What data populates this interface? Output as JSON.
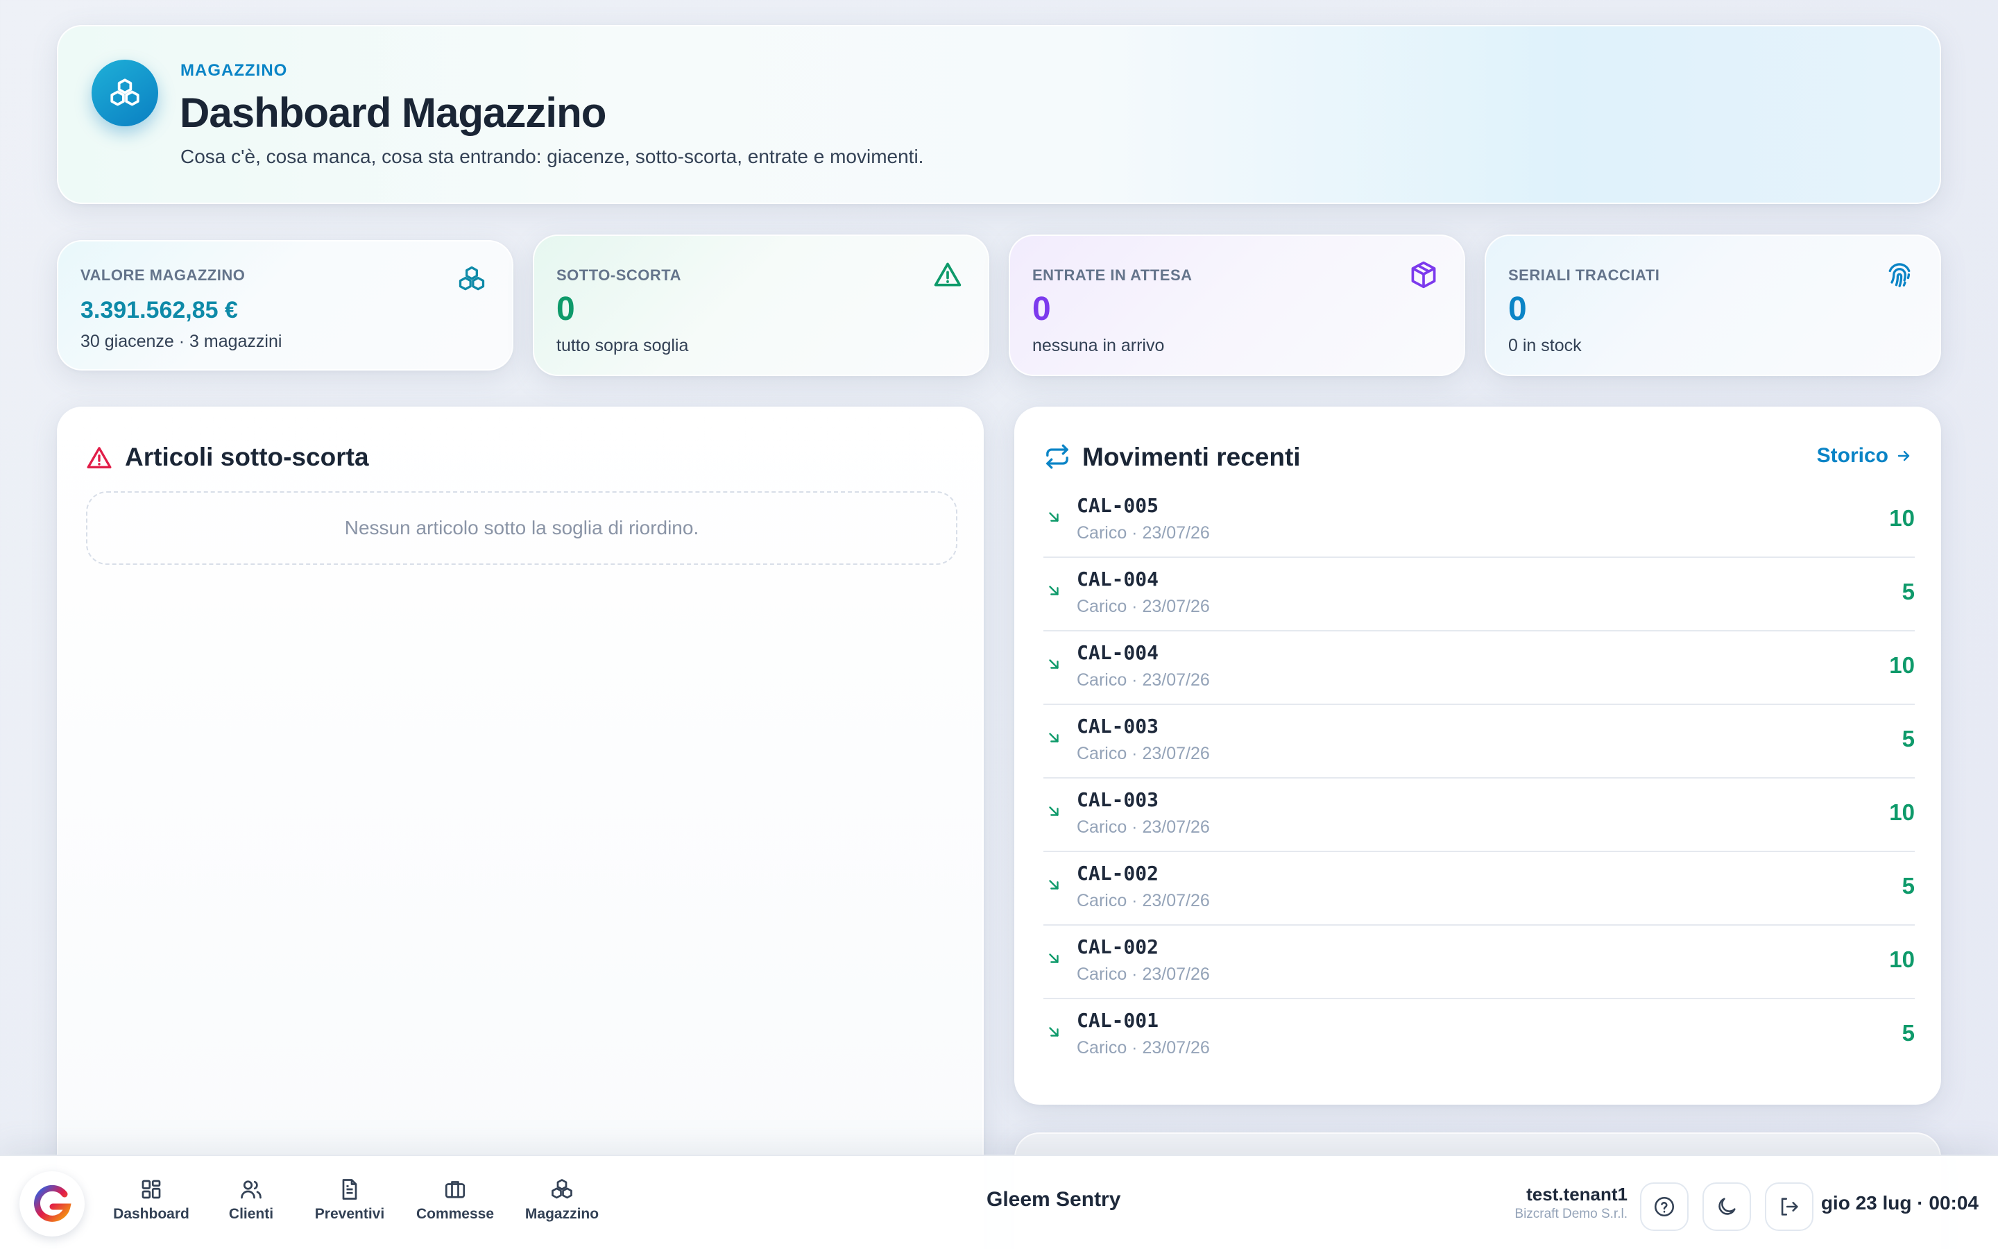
{
  "header": {
    "eyebrow": "MAGAZZINO",
    "title": "Dashboard Magazzino",
    "subtitle": "Cosa c'è, cosa manca, cosa sta entrando: giacenze, sotto-scorta, entrate e movimenti."
  },
  "kpis": [
    {
      "label": "VALORE MAGAZZINO",
      "value": "3.391.562,85 €",
      "sub": "30 giacenze · 3 magazzini",
      "icon": "boxes-icon",
      "color": "#0e8aa8"
    },
    {
      "label": "SOTTO-SCORTA",
      "value": "0",
      "sub": "tutto sopra soglia",
      "icon": "warning-triangle-icon",
      "color": "#0e9a6a"
    },
    {
      "label": "ENTRATE IN ATTESA",
      "value": "0",
      "sub": "nessuna in arrivo",
      "icon": "package-icon",
      "color": "#7c3aed"
    },
    {
      "label": "SERIALI TRACCIATI",
      "value": "0",
      "sub": "0 in stock",
      "icon": "fingerprint-icon",
      "color": "#0a84c6"
    }
  ],
  "low_stock": {
    "title": "Articoli sotto-scorta",
    "empty_text": "Nessun articolo sotto la soglia di riordino."
  },
  "movements": {
    "title": "Movimenti recenti",
    "link_label": "Storico",
    "rows": [
      {
        "code": "CAL-005",
        "meta": "Carico · 23/07/26",
        "qty": "10"
      },
      {
        "code": "CAL-004",
        "meta": "Carico · 23/07/26",
        "qty": "5"
      },
      {
        "code": "CAL-004",
        "meta": "Carico · 23/07/26",
        "qty": "10"
      },
      {
        "code": "CAL-003",
        "meta": "Carico · 23/07/26",
        "qty": "5"
      },
      {
        "code": "CAL-003",
        "meta": "Carico · 23/07/26",
        "qty": "10"
      },
      {
        "code": "CAL-002",
        "meta": "Carico · 23/07/26",
        "qty": "5"
      },
      {
        "code": "CAL-002",
        "meta": "Carico · 23/07/26",
        "qty": "10"
      },
      {
        "code": "CAL-001",
        "meta": "Carico · 23/07/26",
        "qty": "5"
      }
    ]
  },
  "bottom_bar": {
    "nav": [
      {
        "label": "Dashboard",
        "icon": "dashboard-grid-icon"
      },
      {
        "label": "Clienti",
        "icon": "users-icon"
      },
      {
        "label": "Preventivi",
        "icon": "document-icon"
      },
      {
        "label": "Commesse",
        "icon": "briefcase-icon"
      },
      {
        "label": "Magazzino",
        "icon": "boxes-icon"
      }
    ],
    "brand": "Gleem Sentry",
    "user_name": "test.tenant1",
    "user_org": "Bizcraft Demo S.r.l.",
    "clock": "gio 23 lug · 00:04"
  }
}
